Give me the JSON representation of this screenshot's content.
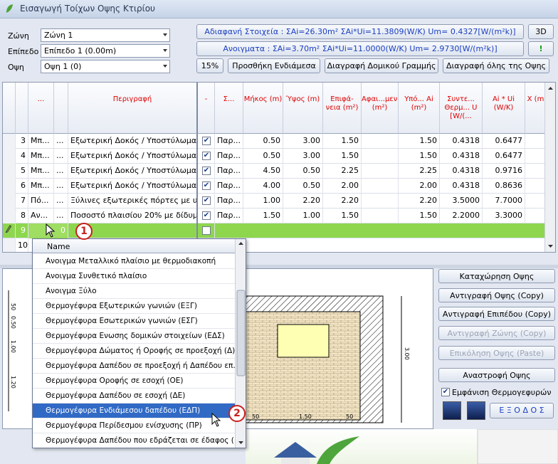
{
  "window": {
    "title": "Εισαγωγή Τοίχων Οψης Κτιρίου"
  },
  "selectors": [
    {
      "label": "Ζώνη",
      "value": "Ζώνη 1"
    },
    {
      "label": "Επίπεδο",
      "value": "Επίπεδο 1 (0.00m)"
    },
    {
      "label": "Οψη",
      "value": "Οψη 1 (0)"
    }
  ],
  "summary": {
    "opaque": "Αδιαφανή Στοιχεία : ΣAi=26.30m²   ΣAi*Ui=11.3809(W/K) Um= 0.4327[W/(m²k)]",
    "openings": "Ανοιγματα  : ΣAi=3.70m²   ΣAi*Ui=11.0000(W/K) Um= 2.9730[W/(m²k)]",
    "btn_3d": "3D",
    "btn_warn": "!"
  },
  "toolbar": {
    "percent": "15%",
    "add_intermediate": "Προσθήκη Ενδιάμεσα",
    "delete_line": "Διαγραφή Δομικού Γραμμής",
    "delete_all": "Διαγραφή όλης της Οψης"
  },
  "grid": {
    "headers": [
      "...",
      "Περιγραφή",
      "-",
      "Σ...",
      "Μήκος (m)",
      "Ύψος (m)",
      "Επιφά-νεια (m²)",
      "Αφαι...μενη (m²)",
      "Υπό... Ai (m²)",
      "Συντε... Θερμ... U [W/(...",
      "Ai * Ui (W/K)",
      "Χ (m"
    ],
    "rows": [
      {
        "num": "3",
        "code": "Μπ...",
        "dots": "...",
        "desc": "Εξωτερική Δοκός / Υποστύλωμα / ...",
        "checked": true,
        "type": "Παρ...",
        "len": "0.50",
        "h": "3.00",
        "area": "1.50",
        "sub": "",
        "rem": "1.50",
        "u": "0.4318",
        "aiui": "0.6477"
      },
      {
        "num": "4",
        "code": "Μπ...",
        "dots": "...",
        "desc": "Εξωτερική Δοκός / Υποστύλωμα / ...",
        "checked": true,
        "type": "Παρ...",
        "len": "0.50",
        "h": "3.00",
        "area": "1.50",
        "sub": "",
        "rem": "1.50",
        "u": "0.4318",
        "aiui": "0.6477"
      },
      {
        "num": "5",
        "code": "Μπ...",
        "dots": "...",
        "desc": "Εξωτερική Δοκός / Υποστύλωμα / ...",
        "checked": true,
        "type": "Παρ...",
        "len": "4.50",
        "h": "0.50",
        "area": "2.25",
        "sub": "",
        "rem": "2.25",
        "u": "0.4318",
        "aiui": "0.9716"
      },
      {
        "num": "6",
        "code": "Μπ...",
        "dots": "...",
        "desc": "Εξωτερική Δοκός / Υποστύλωμα / ...",
        "checked": true,
        "type": "Παρ...",
        "len": "4.00",
        "h": "0.50",
        "area": "2.00",
        "sub": "",
        "rem": "2.00",
        "u": "0.4318",
        "aiui": "0.8636"
      },
      {
        "num": "7",
        "code": "Πό...",
        "dots": "...",
        "desc": "Ξύλινες εξωτερικές πόρτες με υα...",
        "checked": true,
        "type": "Παρ...",
        "len": "1.00",
        "h": "2.20",
        "area": "2.20",
        "sub": "",
        "rem": "2.20",
        "u": "3.5000",
        "aiui": "7.7000"
      },
      {
        "num": "8",
        "code": "Αν...",
        "dots": "...",
        "desc": "Ποσοστό πλαισίου 20% με δίδυμο ...",
        "checked": true,
        "type": "Παρ...",
        "len": "1.50",
        "h": "1.00",
        "area": "1.50",
        "sub": "",
        "rem": "1.50",
        "u": "2.2000",
        "aiui": "3.3000"
      }
    ],
    "edit_row": {
      "num": "9",
      "value": "0"
    },
    "next_row": {
      "num": "10"
    }
  },
  "dropdown": {
    "header": "Name",
    "items": [
      "Ανοιγμα Μεταλλικό πλαίσιο με θερμοδιακοπή",
      "Ανοιγμα Συνθετικό πλαίσιο",
      "Ανοιγμα Ξύλο",
      "Θερμογέφυρα Εξωτερικών γωνιών (ΕΞΓ)",
      "Θερμογέφυρα Εσωτερικών γωνιών (ΕΣΓ)",
      "Θερμογέφυρα Ενωσης δομικών στοιχείων (ΕΔΣ)",
      "Θερμογέφυρα Δώματος ή Οροφής σε προεξοχή (Δ)",
      "Θερμογέφυρα Δαπέδου σε προεξοχή ή Δαπέδου επ...",
      "Θερμογέφυρα Οροφής σε εσοχή (ΟΕ)",
      "Θερμογέφυρα Δαπέδου σε εσοχή (ΔΕ)",
      "Θερμογέφυρα Ενδιάμεσου δαπέδου (ΕΔΠ)",
      "Θερμογέφυρα Περίδεσμου ενίσχυσης (ΠΡ)",
      "Θερμογέφυρα Δαπέδου που εδράζεται σε έδαφος (..."
    ],
    "selected_index": 10
  },
  "drawing": {
    "dims_left": [
      "50",
      "0.50",
      "1.00",
      "1.20"
    ],
    "dim_right": "3.00",
    "dims_bottom": [
      "50",
      "1.50",
      "50"
    ]
  },
  "actions": {
    "save": "Καταχώρηση Οψης",
    "copy_view": "Αντιγραφή Οψης (Copy)",
    "copy_level": "Αντιγραφή Επιπέδου (Copy)",
    "copy_zone": "Αντιγραφή Ζώνης (Copy)",
    "paste_view": "Επικόληση Οψης (Paste)",
    "flip_view": "Αναστροφή Οψης",
    "show_bridges": "Εμφάνιση Θερμογεφυρών",
    "exit": "Ε Ξ Ο Δ Ο Σ"
  },
  "callouts": [
    "1",
    "2"
  ],
  "colors": {
    "accent": "#316ac5",
    "edit_row": "#8fd64f",
    "header_text": "#dd0000"
  }
}
